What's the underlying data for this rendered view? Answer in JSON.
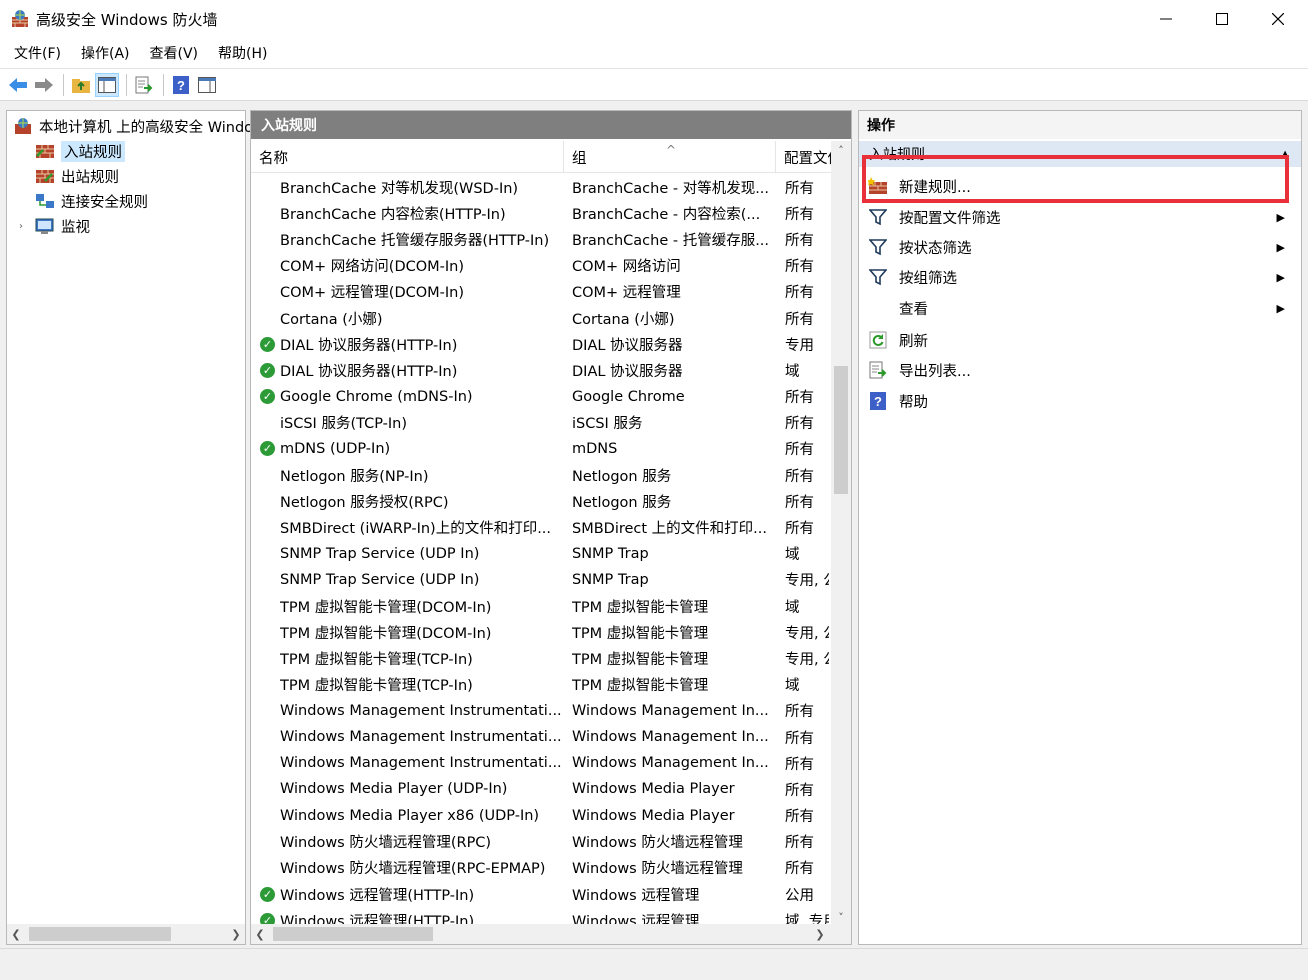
{
  "window": {
    "title": "高级安全 Windows 防火墙",
    "minimize": "—",
    "maximize": "☐",
    "close": "✕"
  },
  "menu": [
    "文件(F)",
    "操作(A)",
    "查看(V)",
    "帮助(H)"
  ],
  "toolbar": {
    "icons": [
      "back-arrow-icon",
      "forward-arrow-icon",
      "up-folder-icon",
      "show-hide-console-tree-icon",
      "export-list-icon",
      "help-icon",
      "show-hide-action-pane-icon"
    ]
  },
  "tree": {
    "root": "本地计算机 上的高级安全 Windows",
    "items": [
      "入站规则",
      "出站规则",
      "连接安全规则",
      "监视"
    ],
    "selected_index": 0
  },
  "middle": {
    "header": "入站规则",
    "columns": [
      "名称",
      "组",
      "配置文件"
    ],
    "rows": [
      {
        "name": "BranchCache 对等机发现(WSD-In)",
        "group": "BranchCache - 对等机发现...",
        "profile": "所有",
        "enabled": false
      },
      {
        "name": "BranchCache 内容检索(HTTP-In)",
        "group": "BranchCache - 内容检索(...",
        "profile": "所有",
        "enabled": false
      },
      {
        "name": "BranchCache 托管缓存服务器(HTTP-In)",
        "group": "BranchCache - 托管缓存服...",
        "profile": "所有",
        "enabled": false
      },
      {
        "name": "COM+ 网络访问(DCOM-In)",
        "group": "COM+ 网络访问",
        "profile": "所有",
        "enabled": false
      },
      {
        "name": "COM+ 远程管理(DCOM-In)",
        "group": "COM+ 远程管理",
        "profile": "所有",
        "enabled": false
      },
      {
        "name": "Cortana (小娜)",
        "group": "Cortana (小娜)",
        "profile": "所有",
        "enabled": false
      },
      {
        "name": "DIAL 协议服务器(HTTP-In)",
        "group": "DIAL 协议服务器",
        "profile": "专用",
        "enabled": true
      },
      {
        "name": "DIAL 协议服务器(HTTP-In)",
        "group": "DIAL 协议服务器",
        "profile": "域",
        "enabled": true
      },
      {
        "name": "Google Chrome (mDNS-In)",
        "group": "Google Chrome",
        "profile": "所有",
        "enabled": true
      },
      {
        "name": "iSCSI 服务(TCP-In)",
        "group": "iSCSI 服务",
        "profile": "所有",
        "enabled": false
      },
      {
        "name": "mDNS (UDP-In)",
        "group": "mDNS",
        "profile": "所有",
        "enabled": true
      },
      {
        "name": "Netlogon 服务(NP-In)",
        "group": "Netlogon 服务",
        "profile": "所有",
        "enabled": false
      },
      {
        "name": "Netlogon 服务授权(RPC)",
        "group": "Netlogon 服务",
        "profile": "所有",
        "enabled": false
      },
      {
        "name": "SMBDirect (iWARP-In)上的文件和打印...",
        "group": "SMBDirect 上的文件和打印...",
        "profile": "所有",
        "enabled": false
      },
      {
        "name": "SNMP Trap Service (UDP In)",
        "group": "SNMP Trap",
        "profile": "域",
        "enabled": false
      },
      {
        "name": "SNMP Trap Service (UDP In)",
        "group": "SNMP Trap",
        "profile": "专用, 公",
        "enabled": false
      },
      {
        "name": "TPM 虚拟智能卡管理(DCOM-In)",
        "group": "TPM 虚拟智能卡管理",
        "profile": "域",
        "enabled": false
      },
      {
        "name": "TPM 虚拟智能卡管理(DCOM-In)",
        "group": "TPM 虚拟智能卡管理",
        "profile": "专用, 公",
        "enabled": false
      },
      {
        "name": "TPM 虚拟智能卡管理(TCP-In)",
        "group": "TPM 虚拟智能卡管理",
        "profile": "专用, 公",
        "enabled": false
      },
      {
        "name": "TPM 虚拟智能卡管理(TCP-In)",
        "group": "TPM 虚拟智能卡管理",
        "profile": "域",
        "enabled": false
      },
      {
        "name": "Windows Management Instrumentati...",
        "group": "Windows Management In...",
        "profile": "所有",
        "enabled": false
      },
      {
        "name": "Windows Management Instrumentati...",
        "group": "Windows Management In...",
        "profile": "所有",
        "enabled": false
      },
      {
        "name": "Windows Management Instrumentati...",
        "group": "Windows Management In...",
        "profile": "所有",
        "enabled": false
      },
      {
        "name": "Windows Media Player (UDP-In)",
        "group": "Windows Media Player",
        "profile": "所有",
        "enabled": false
      },
      {
        "name": "Windows Media Player x86 (UDP-In)",
        "group": "Windows Media Player",
        "profile": "所有",
        "enabled": false
      },
      {
        "name": "Windows 防火墙远程管理(RPC)",
        "group": "Windows 防火墙远程管理",
        "profile": "所有",
        "enabled": false
      },
      {
        "name": "Windows 防火墙远程管理(RPC-EPMAP)",
        "group": "Windows 防火墙远程管理",
        "profile": "所有",
        "enabled": false
      },
      {
        "name": "Windows 远程管理(HTTP-In)",
        "group": "Windows 远程管理",
        "profile": "公用",
        "enabled": true
      },
      {
        "name": "Windows 远程管理(HTTP-In)",
        "group": "Windows 远程管理",
        "profile": "域, 专用",
        "enabled": true
      }
    ]
  },
  "actions": {
    "header": "操作",
    "section": "入站规则",
    "items": [
      {
        "label": "新建规则...",
        "icon": "new-rule-icon",
        "submenu": false
      },
      {
        "label": "按配置文件筛选",
        "icon": "filter-icon",
        "submenu": true
      },
      {
        "label": "按状态筛选",
        "icon": "filter-icon",
        "submenu": true
      },
      {
        "label": "按组筛选",
        "icon": "filter-icon",
        "submenu": true
      },
      {
        "label": "查看",
        "icon": "",
        "submenu": true
      },
      {
        "label": "刷新",
        "icon": "refresh-icon",
        "submenu": false
      },
      {
        "label": "导出列表...",
        "icon": "export-list-icon",
        "submenu": false
      },
      {
        "label": "帮助",
        "icon": "help-icon",
        "submenu": false
      }
    ]
  },
  "colors": {
    "highlight": "#e8303a",
    "selection": "#cce8ff",
    "header_gray": "#7f7f7f",
    "enabled_green": "#2c9a36"
  }
}
